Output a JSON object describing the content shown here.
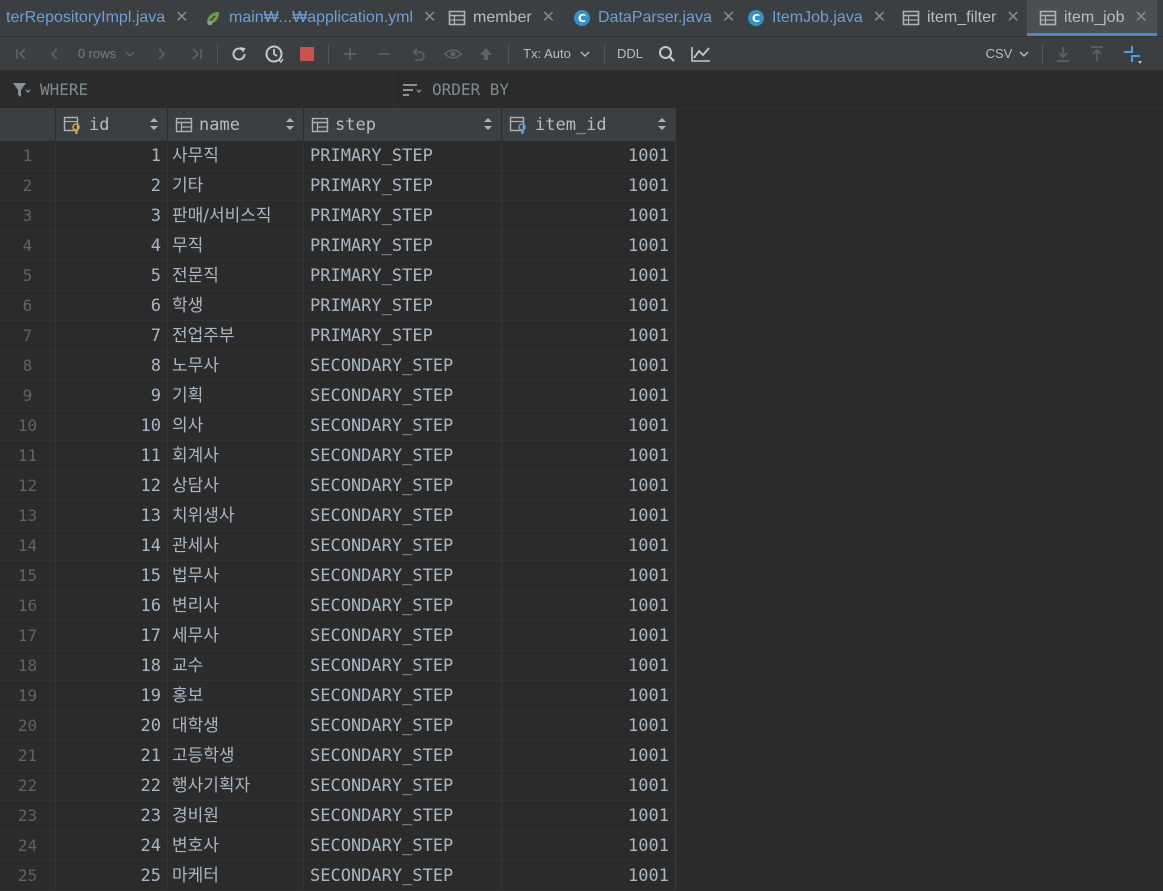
{
  "tabs": [
    {
      "title": "terRepositoryImpl.java",
      "icon": "none",
      "active": false
    },
    {
      "title": "main₩...₩application.yml",
      "icon": "yaml-leaf-icon",
      "active": false
    },
    {
      "title": "member",
      "icon": "table-icon",
      "active": false
    },
    {
      "title": "DataParser.java",
      "icon": "class-icon",
      "active": false
    },
    {
      "title": "ItemJob.java",
      "icon": "class-icon",
      "active": false
    },
    {
      "title": "item_filter",
      "icon": "table-icon",
      "active": false
    },
    {
      "title": "item_job",
      "icon": "table-icon",
      "active": true
    }
  ],
  "toolbar": {
    "rows_label": "0 rows",
    "tx_label": "Tx: Auto",
    "ddl_label": "DDL",
    "export_format": "CSV"
  },
  "filter": {
    "where_label": "WHERE",
    "order_by_label": "ORDER BY"
  },
  "columns": [
    {
      "name": "id",
      "icon": "key-column-icon"
    },
    {
      "name": "name",
      "icon": "column-icon"
    },
    {
      "name": "step",
      "icon": "column-icon"
    },
    {
      "name": "item_id",
      "icon": "fk-column-icon"
    }
  ],
  "rows": [
    {
      "row": "1",
      "id": "1",
      "name": "사무직",
      "step": "PRIMARY_STEP",
      "item_id": "1001"
    },
    {
      "row": "2",
      "id": "2",
      "name": "기타",
      "step": "PRIMARY_STEP",
      "item_id": "1001"
    },
    {
      "row": "3",
      "id": "3",
      "name": "판매/서비스직",
      "step": "PRIMARY_STEP",
      "item_id": "1001"
    },
    {
      "row": "4",
      "id": "4",
      "name": "무직",
      "step": "PRIMARY_STEP",
      "item_id": "1001"
    },
    {
      "row": "5",
      "id": "5",
      "name": "전문직",
      "step": "PRIMARY_STEP",
      "item_id": "1001"
    },
    {
      "row": "6",
      "id": "6",
      "name": "학생",
      "step": "PRIMARY_STEP",
      "item_id": "1001"
    },
    {
      "row": "7",
      "id": "7",
      "name": "전업주부",
      "step": "PRIMARY_STEP",
      "item_id": "1001"
    },
    {
      "row": "8",
      "id": "8",
      "name": "노무사",
      "step": "SECONDARY_STEP",
      "item_id": "1001"
    },
    {
      "row": "9",
      "id": "9",
      "name": "기획",
      "step": "SECONDARY_STEP",
      "item_id": "1001"
    },
    {
      "row": "10",
      "id": "10",
      "name": "의사",
      "step": "SECONDARY_STEP",
      "item_id": "1001"
    },
    {
      "row": "11",
      "id": "11",
      "name": "회계사",
      "step": "SECONDARY_STEP",
      "item_id": "1001"
    },
    {
      "row": "12",
      "id": "12",
      "name": "상담사",
      "step": "SECONDARY_STEP",
      "item_id": "1001"
    },
    {
      "row": "13",
      "id": "13",
      "name": "치위생사",
      "step": "SECONDARY_STEP",
      "item_id": "1001"
    },
    {
      "row": "14",
      "id": "14",
      "name": "관세사",
      "step": "SECONDARY_STEP",
      "item_id": "1001"
    },
    {
      "row": "15",
      "id": "15",
      "name": "법무사",
      "step": "SECONDARY_STEP",
      "item_id": "1001"
    },
    {
      "row": "16",
      "id": "16",
      "name": "변리사",
      "step": "SECONDARY_STEP",
      "item_id": "1001"
    },
    {
      "row": "17",
      "id": "17",
      "name": "세무사",
      "step": "SECONDARY_STEP",
      "item_id": "1001"
    },
    {
      "row": "18",
      "id": "18",
      "name": "교수",
      "step": "SECONDARY_STEP",
      "item_id": "1001"
    },
    {
      "row": "19",
      "id": "19",
      "name": "홍보",
      "step": "SECONDARY_STEP",
      "item_id": "1001"
    },
    {
      "row": "20",
      "id": "20",
      "name": "대학생",
      "step": "SECONDARY_STEP",
      "item_id": "1001"
    },
    {
      "row": "21",
      "id": "21",
      "name": "고등학생",
      "step": "SECONDARY_STEP",
      "item_id": "1001"
    },
    {
      "row": "22",
      "id": "22",
      "name": "행사기획자",
      "step": "SECONDARY_STEP",
      "item_id": "1001"
    },
    {
      "row": "23",
      "id": "23",
      "name": "경비원",
      "step": "SECONDARY_STEP",
      "item_id": "1001"
    },
    {
      "row": "24",
      "id": "24",
      "name": "변호사",
      "step": "SECONDARY_STEP",
      "item_id": "1001"
    },
    {
      "row": "25",
      "id": "25",
      "name": "마케터",
      "step": "SECONDARY_STEP",
      "item_id": "1001"
    }
  ],
  "colors": {
    "background": "#2b2b2b",
    "panel": "#3c3f41",
    "accent": "#4a88c7",
    "text": "#a9b7c6",
    "stop_red": "#c75450"
  }
}
